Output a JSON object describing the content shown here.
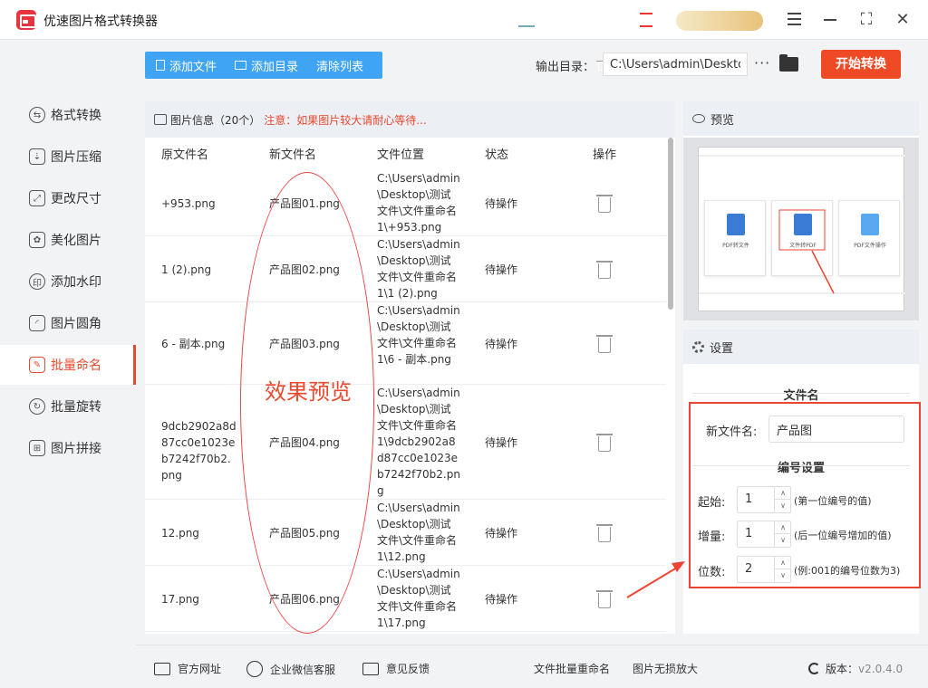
{
  "app": {
    "title": "优速图片格式转换器"
  },
  "sidebar": {
    "items": [
      {
        "label": "格式转换",
        "glyph": "⇆"
      },
      {
        "label": "图片压缩",
        "glyph": "⇣"
      },
      {
        "label": "更改尺寸",
        "glyph": "⤢"
      },
      {
        "label": "美化图片",
        "glyph": "✿"
      },
      {
        "label": "添加水印",
        "glyph": "印"
      },
      {
        "label": "图片圆角",
        "glyph": "◜"
      },
      {
        "label": "批量命名",
        "glyph": "✎"
      },
      {
        "label": "批量旋转",
        "glyph": "↻"
      },
      {
        "label": "图片拼接",
        "glyph": "⊞"
      }
    ],
    "active_index": 6
  },
  "toolbar": {
    "add_file": "添加文件",
    "add_dir": "添加目录",
    "clear_list": "清除列表"
  },
  "output": {
    "label": "输出目录：",
    "path": "C:\\Users\\admin\\Deskto",
    "more": "···"
  },
  "start_button": "开始转换",
  "file_panel": {
    "title": "图片信息（20个）",
    "warning": "注意：如果图片较大请耐心等待...",
    "columns": [
      "原文件名",
      "新文件名",
      "文件位置",
      "状态",
      "操作"
    ],
    "rows": [
      {
        "orig": "+953.png",
        "new": "产品图01.png",
        "path": "C:\\Users\\admin\\Desktop\\测试文件\\文件重命名1\\+953.png",
        "status": "待操作"
      },
      {
        "orig": "1 (2).png",
        "new": "产品图02.png",
        "path": "C:\\Users\\admin\\Desktop\\测试文件\\文件重命名1\\1 (2).png",
        "status": "待操作"
      },
      {
        "orig": "6 - 副本.png",
        "new": "产品图03.png",
        "path": "C:\\Users\\admin\\Desktop\\测试文件\\文件重命名1\\6 - 副本.png",
        "status": "待操作"
      },
      {
        "orig": "9dcb2902a8d87cc0e1023eb7242f70b2.png",
        "new": "产品图04.png",
        "path": "C:\\Users\\admin\\Desktop\\测试文件\\文件重命名1\\9dcb2902a8d87cc0e1023eb7242f70b2.png",
        "status": "待操作"
      },
      {
        "orig": "12.png",
        "new": "产品图05.png",
        "path": "C:\\Users\\admin\\Desktop\\测试文件\\文件重命名1\\12.png",
        "status": "待操作"
      },
      {
        "orig": "17.png",
        "new": "产品图06.png",
        "path": "C:\\Users\\admin\\Desktop\\测试文件\\文件重命名1\\17.png",
        "status": "待操作"
      }
    ],
    "overlay_text": "效果预览"
  },
  "preview": {
    "title": "预览",
    "cards": [
      "PDF转文件",
      "文件转PDF",
      "PDF文件操作"
    ]
  },
  "settings": {
    "title": "设置",
    "filename_section": "文件名",
    "new_name_label": "新文件名:",
    "new_name_value": "产品图",
    "numbering_section": "编号设置",
    "start_label": "起始:",
    "start_value": "1",
    "start_hint": "(第一位编号的值)",
    "step_label": "增量:",
    "step_value": "1",
    "step_hint": "(后一位编号增加的值)",
    "digits_label": "位数:",
    "digits_value": "2",
    "digits_hint": "(例:001的编号位数为3)"
  },
  "footer": {
    "website": "官方网址",
    "wechat": "企业微信客服",
    "feedback": "意见反馈",
    "link1": "文件批量重命名",
    "link2": "图片无损放大",
    "version_label": "版本：",
    "version_value": "v2.0.4.0"
  },
  "colors": {
    "accent": "#ee4a26",
    "toolbar_blue": "#3fa4f3",
    "annotation_red": "#e43"
  }
}
